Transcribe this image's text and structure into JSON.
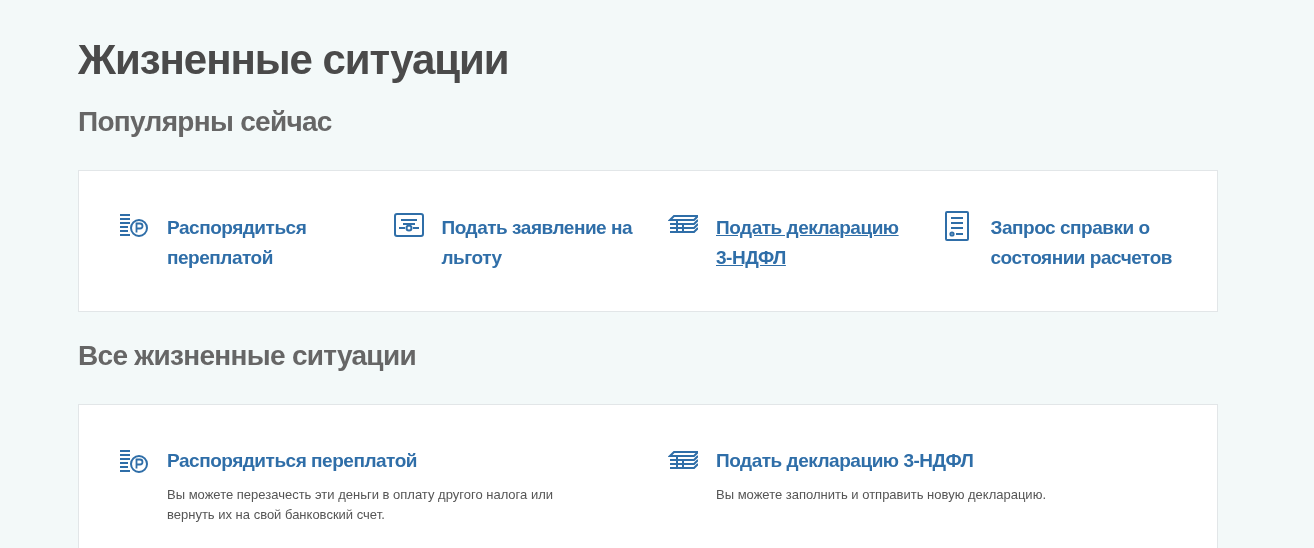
{
  "title": "Жизненные ситуации",
  "popular": {
    "heading": "Популярны сейчас",
    "items": [
      {
        "kind": "coins",
        "label": "Распорядиться переплатой",
        "hovered": false
      },
      {
        "kind": "certificate",
        "label": "Подать заявление на льготу",
        "hovered": false
      },
      {
        "kind": "stack",
        "label": "Подать декларацию 3-НДФЛ",
        "hovered": true
      },
      {
        "kind": "document",
        "label": "Запрос справки о состоянии расчетов",
        "hovered": false
      }
    ]
  },
  "all": {
    "heading": "Все жизненные ситуации",
    "items": [
      {
        "kind": "coins",
        "label": "Распорядиться переплатой",
        "description": "Вы можете перезачесть эти деньги в оплату другого налога или вернуть их на свой банковский счет."
      },
      {
        "kind": "stack",
        "label": "Подать декларацию 3-НДФЛ",
        "description": "Вы можете заполнить и отправить новую декларацию."
      }
    ]
  }
}
